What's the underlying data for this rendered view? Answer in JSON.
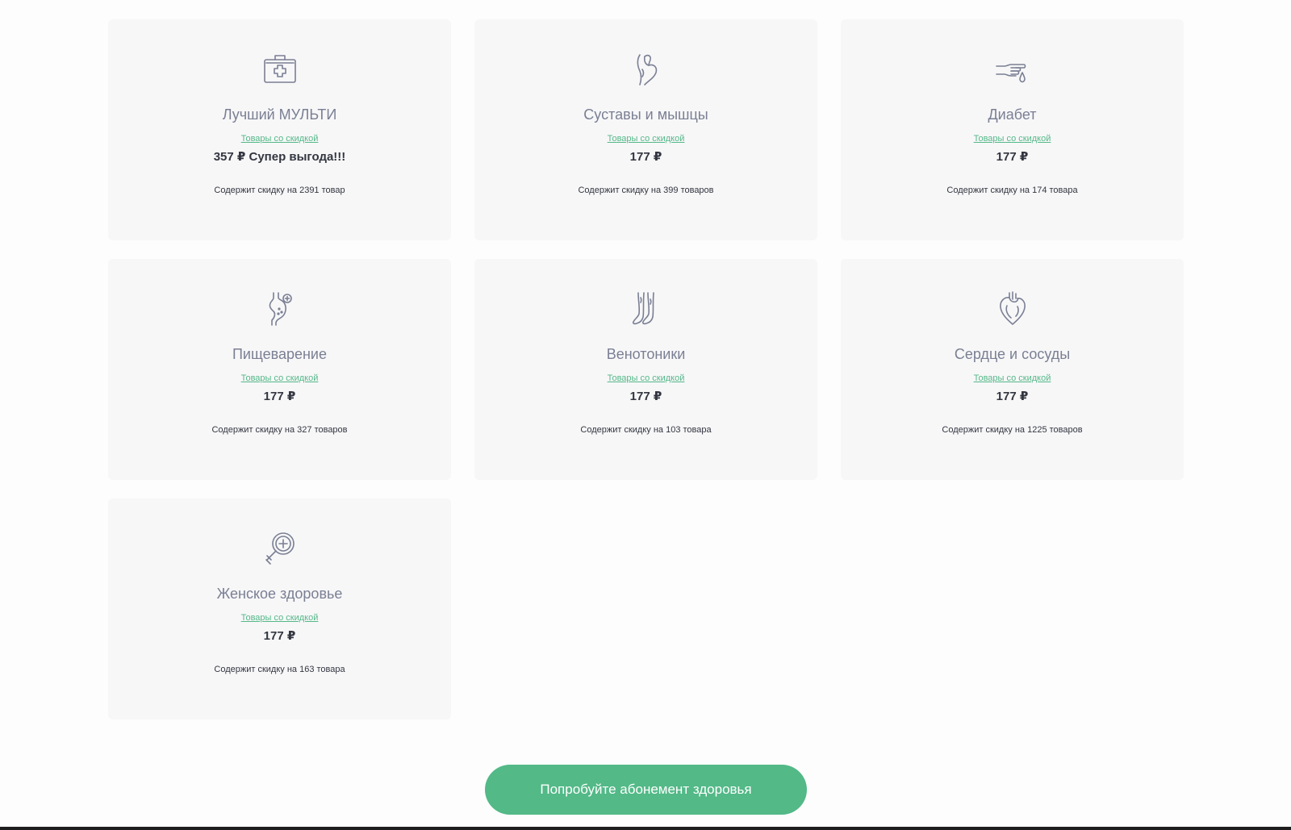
{
  "cards": [
    {
      "icon": "first-aid-kit-icon",
      "title": "Лучший МУЛЬТИ",
      "link": "Товары со скидкой",
      "price": "357 ₽ Супер выгода!!!",
      "count": "Содержит скидку на 2391 товар"
    },
    {
      "icon": "joint-icon",
      "title": "Суставы и мышцы",
      "link": "Товары со скидкой",
      "price": "177 ₽",
      "count": "Содержит скидку на 399 товаров"
    },
    {
      "icon": "finger-blood-drop-icon",
      "title": "Диабет",
      "link": "Товары со скидкой",
      "price": "177 ₽",
      "count": "Содержит скидку на 174 товара"
    },
    {
      "icon": "stomach-icon",
      "title": "Пищеварение",
      "link": "Товары со скидкой",
      "price": "177 ₽",
      "count": "Содержит скидку на 327 товаров"
    },
    {
      "icon": "legs-icon",
      "title": "Венотоники",
      "link": "Товары со скидкой",
      "price": "177 ₽",
      "count": "Содержит скидку на 103 товара"
    },
    {
      "icon": "heart-icon",
      "title": "Сердце и сосуды",
      "link": "Товары со скидкой",
      "price": "177 ₽",
      "count": "Содержит скидку на 1225 товаров"
    },
    {
      "icon": "female-health-icon",
      "title": "Женское здоровье",
      "link": "Товары со скидкой",
      "price": "177 ₽",
      "count": "Содержит скидку на 163 товара"
    }
  ],
  "cta": {
    "label": "Попробуйте абонемент здоровья"
  },
  "colors": {
    "accent": "#52b987",
    "link": "#55b888",
    "title": "#7a7f93",
    "card_bg": "#f7f7f8",
    "text": "#333640"
  }
}
